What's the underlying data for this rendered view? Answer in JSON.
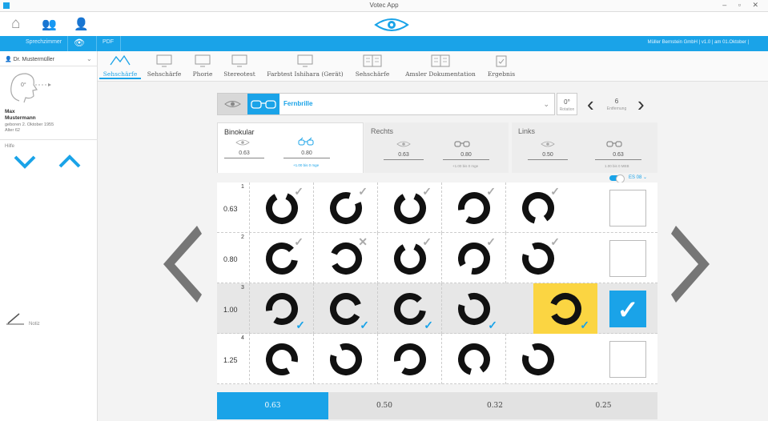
{
  "app": {
    "title": "Votec App",
    "window_buttons": "– ▫ ✕"
  },
  "nav": {
    "tab1_label": "Sprechzimmer",
    "tab2_label": "PDF",
    "right_text": "Müller Bernstein GmbH | v1.0 | am 01.Oktober |"
  },
  "sidebar": {
    "doctor": "Dr. Mustermüller",
    "angle": "0°",
    "patient_name_line1": "Max",
    "patient_name_line2": "Mustermann",
    "born": "geboren 2. Oktober 1955",
    "age": "Alter 62",
    "help_label": "Hilfe",
    "note_label": "Notiz"
  },
  "tests": [
    {
      "label": "Sehschärfe",
      "active": true
    },
    {
      "label": "Sehschärfe",
      "active": false
    },
    {
      "label": "Phorie",
      "active": false
    },
    {
      "label": "Stereotest",
      "active": false
    },
    {
      "label": "Farbtest Ishihara (Gerät)",
      "active": false
    },
    {
      "label": "Sehschärfe",
      "active": false
    },
    {
      "label": "Amsler Dokumentation",
      "active": false
    },
    {
      "label": "Ergebnis",
      "active": false
    }
  ],
  "lens": {
    "name": "Fernbrille",
    "rotation_value": "0°",
    "rotation_label": "Rotation",
    "distance_value": "6",
    "distance_label": "Entfernung"
  },
  "eyes": {
    "binokular": {
      "title": "Binokular",
      "v1": "0.63",
      "v2": "0.80",
      "sub": "+1.00 bis 0 mge"
    },
    "rechts": {
      "title": "Rechts",
      "v1": "0.63",
      "v2": "0.80",
      "sub": "+1.00 bis 0 mge"
    },
    "links": {
      "title": "Links",
      "v1": "0.50",
      "v2": "0.63",
      "sub": "1.00 bis 0 MEB"
    }
  },
  "toggle_label": "ES 08",
  "rows": [
    {
      "num": "1",
      "label": "0.63"
    },
    {
      "num": "2",
      "label": "0.80"
    },
    {
      "num": "3",
      "label": "1.00"
    },
    {
      "num": "4",
      "label": "1.25"
    }
  ],
  "footer": [
    "0.63",
    "0.50",
    "0.32",
    "0.25"
  ],
  "colors": {
    "accent": "#1aa3e8",
    "highlight": "#fbd542"
  }
}
